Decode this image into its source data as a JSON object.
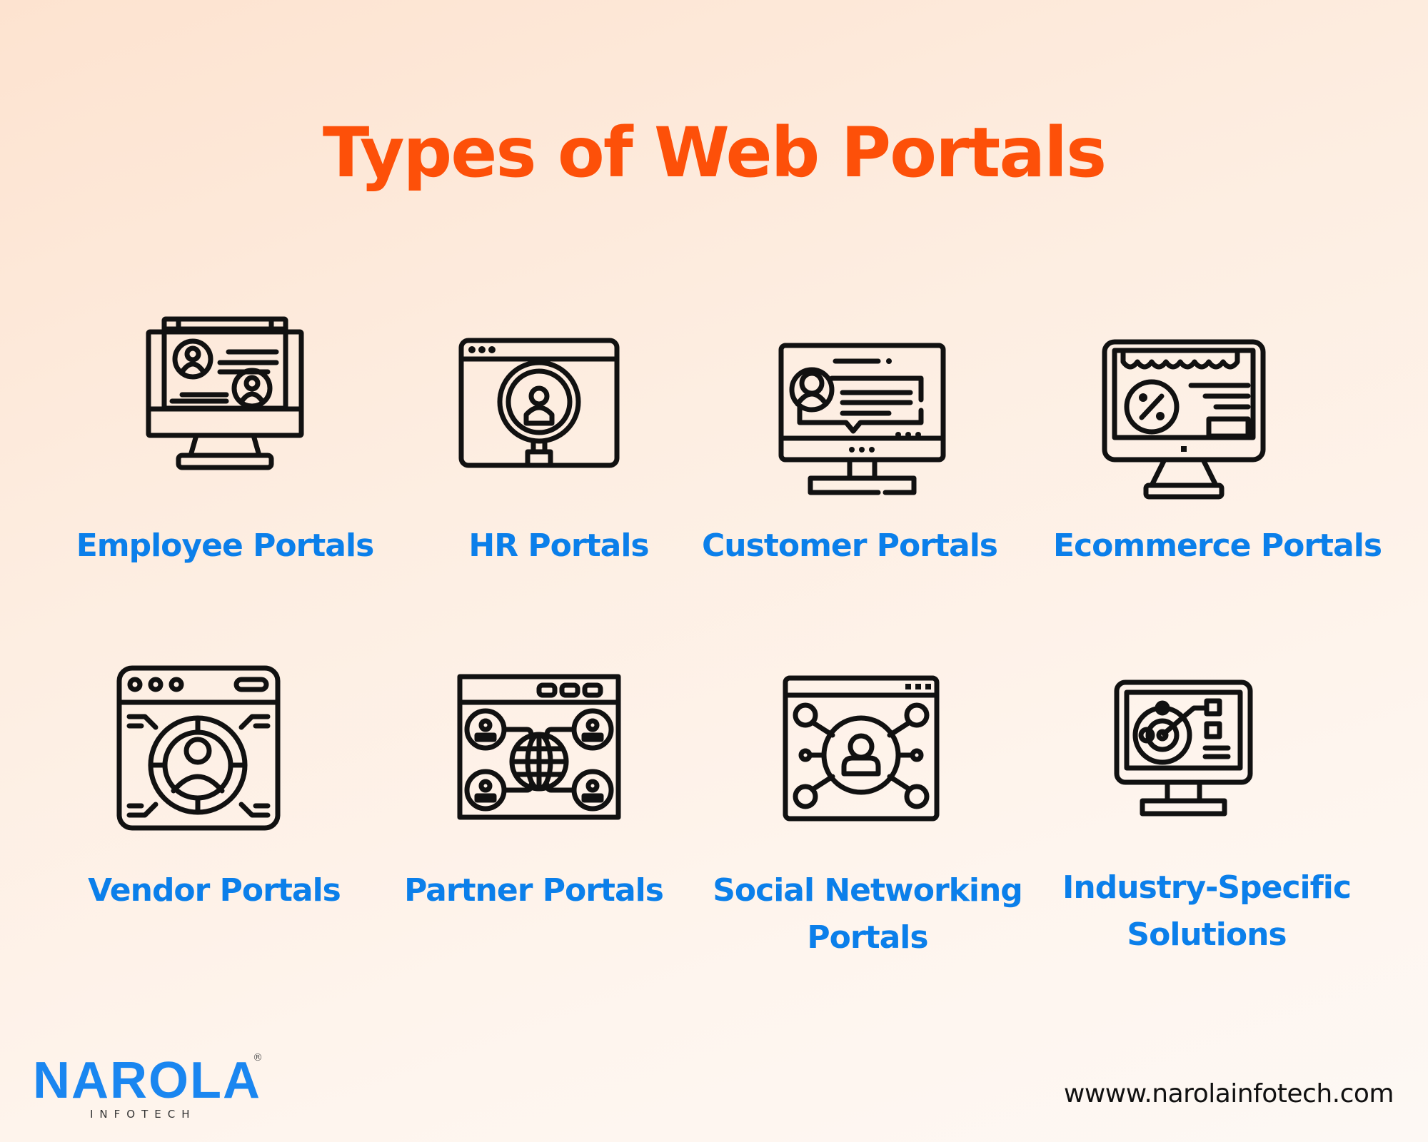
{
  "header": {
    "title": "Types of Web Portals"
  },
  "colors": {
    "title": "#fd5009",
    "label": "#0b7fea",
    "logo": "#1a86f0",
    "icon_stroke": "#111111"
  },
  "portals": [
    {
      "label": "Employee Portals",
      "icon": "employee-monitor-icon"
    },
    {
      "label": "HR Portals",
      "icon": "hr-magnifier-icon"
    },
    {
      "label": "Customer Portals",
      "icon": "customer-chat-monitor-icon"
    },
    {
      "label": "Ecommerce Portals",
      "icon": "ecommerce-storefront-monitor-icon"
    },
    {
      "label": "Vendor Portals",
      "icon": "vendor-target-window-icon"
    },
    {
      "label": "Partner Portals",
      "icon": "partner-globe-network-icon"
    },
    {
      "label_line1": "Social Networking",
      "label_line2": "Portals",
      "icon": "social-network-window-icon"
    },
    {
      "label_line1": "Industry-Specific",
      "label_line2": "Solutions",
      "icon": "industry-radar-monitor-icon"
    }
  ],
  "footer": {
    "logo_word": "NAROLA",
    "logo_sub": "INFOTECH",
    "logo_reg": "®",
    "url": "wwww.narolainfotech.com"
  }
}
